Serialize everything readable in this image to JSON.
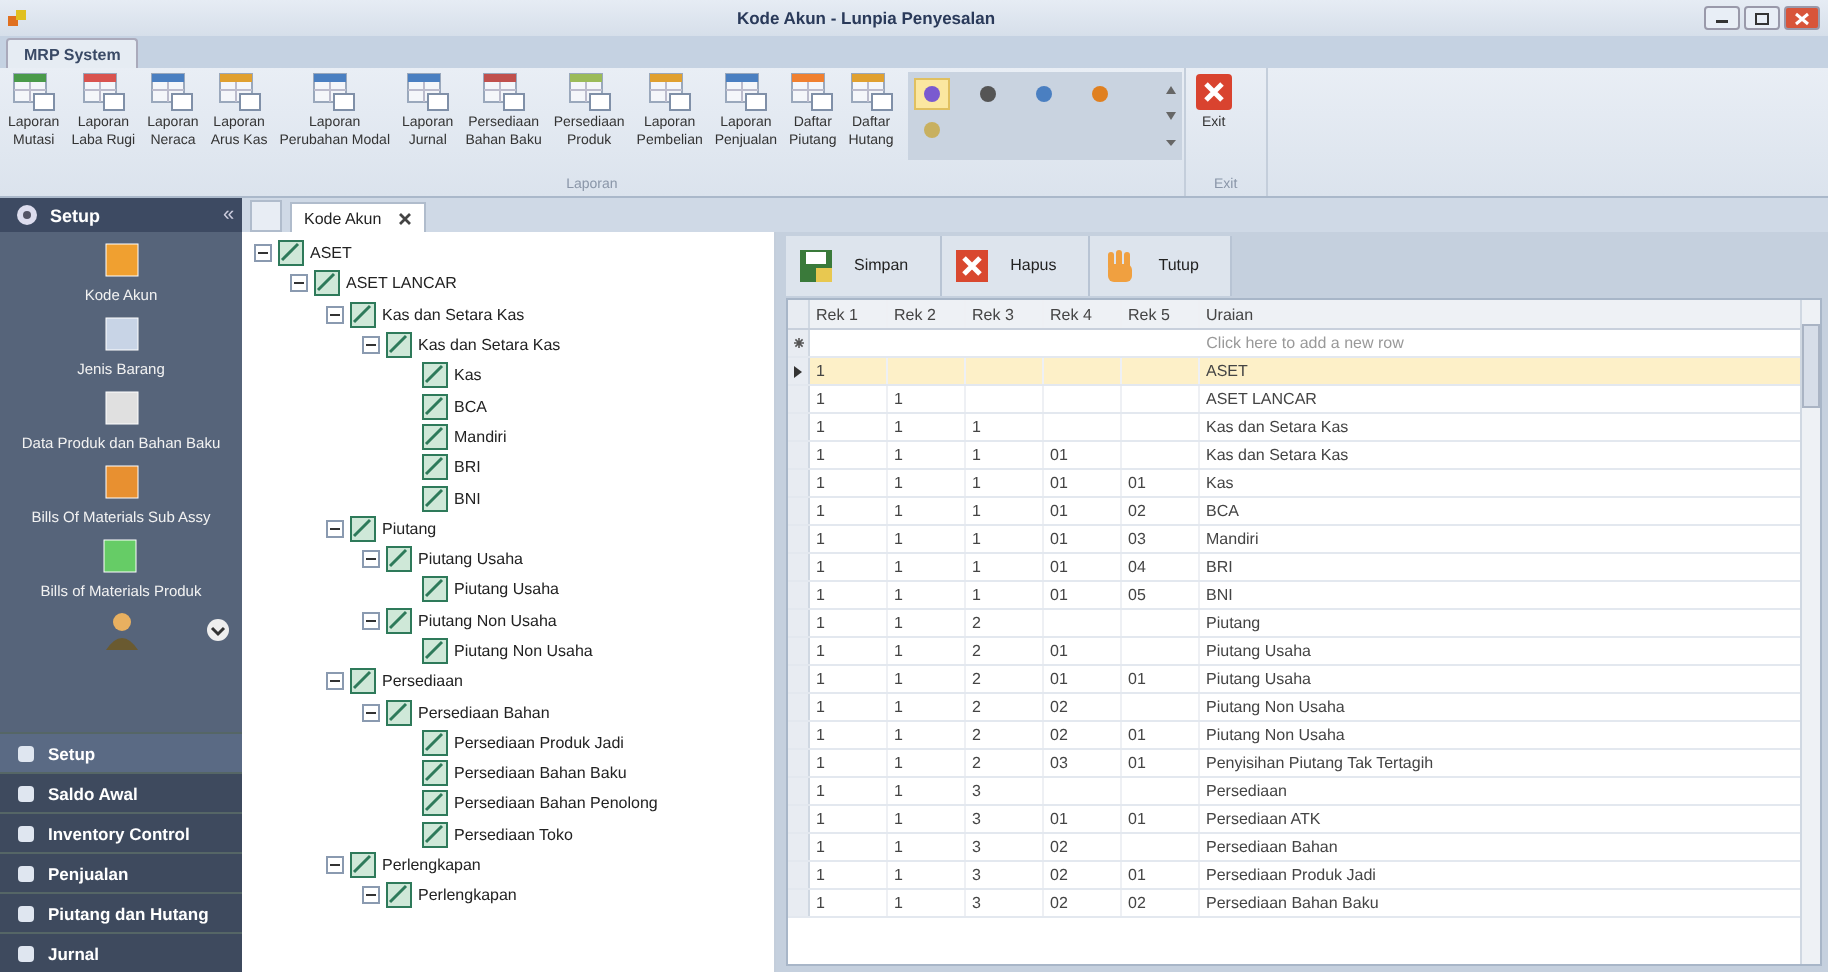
{
  "window": {
    "title": "Kode Akun - Lunpia Penyesalan"
  },
  "ribbon": {
    "tabs": [
      {
        "label": "MRP System",
        "selected": true
      }
    ],
    "report_group": {
      "label": "Laporan",
      "buttons": [
        {
          "lines": [
            "Laporan",
            "Mutasi"
          ]
        },
        {
          "lines": [
            "Laporan",
            "Laba Rugi"
          ]
        },
        {
          "lines": [
            "Laporan",
            "Neraca"
          ]
        },
        {
          "lines": [
            "Laporan",
            "Arus Kas"
          ]
        },
        {
          "lines": [
            "Laporan",
            "Perubahan Modal"
          ]
        },
        {
          "lines": [
            "Laporan",
            "Jurnal"
          ]
        },
        {
          "lines": [
            "Persediaan",
            "Bahan Baku"
          ]
        },
        {
          "lines": [
            "Persediaan",
            "Produk"
          ]
        },
        {
          "lines": [
            "Laporan",
            "Pembelian"
          ]
        },
        {
          "lines": [
            "Laporan",
            "Penjualan"
          ]
        },
        {
          "lines": [
            "Daftar",
            "Piutang"
          ]
        },
        {
          "lines": [
            "Daftar",
            "Hutang"
          ]
        }
      ]
    },
    "gallery": [
      {
        "selected": true
      },
      {
        "selected": false
      },
      {
        "selected": false
      },
      {
        "selected": false
      },
      {
        "selected": false
      }
    ],
    "exit_group": {
      "label": "Exit",
      "button": "Exit"
    }
  },
  "sidebar": {
    "header": "Setup",
    "collapse_glyph": "«",
    "items": [
      {
        "label": "Kode Akun"
      },
      {
        "label": "Jenis Barang"
      },
      {
        "label": "Data Produk dan Bahan Baku"
      },
      {
        "label": "Bills Of Materials Sub Assy"
      },
      {
        "label": "Bills of Materials Produk"
      }
    ],
    "nav": [
      {
        "label": "Setup",
        "selected": true
      },
      {
        "label": "Saldo Awal",
        "selected": false
      },
      {
        "label": "Inventory Control",
        "selected": false
      },
      {
        "label": "Penjualan",
        "selected": false
      },
      {
        "label": "Piutang dan Hutang",
        "selected": false
      },
      {
        "label": "Jurnal",
        "selected": false
      }
    ]
  },
  "document_tabs": [
    {
      "label": "Kode Akun",
      "selected": true
    }
  ],
  "tree": [
    {
      "label": "ASET",
      "expanded": true,
      "children": [
        {
          "label": "ASET LANCAR",
          "expanded": true,
          "children": [
            {
              "label": "Kas dan Setara Kas",
              "expanded": true,
              "children": [
                {
                  "label": "Kas dan Setara Kas",
                  "expanded": true,
                  "children": [
                    {
                      "label": "Kas"
                    },
                    {
                      "label": "BCA"
                    },
                    {
                      "label": "Mandiri"
                    },
                    {
                      "label": "BRI"
                    },
                    {
                      "label": "BNI"
                    }
                  ]
                }
              ]
            },
            {
              "label": "Piutang",
              "expanded": true,
              "children": [
                {
                  "label": "Piutang Usaha",
                  "expanded": true,
                  "children": [
                    {
                      "label": "Piutang Usaha"
                    }
                  ]
                },
                {
                  "label": "Piutang Non Usaha",
                  "expanded": true,
                  "children": [
                    {
                      "label": "Piutang Non Usaha"
                    }
                  ]
                }
              ]
            },
            {
              "label": "Persediaan",
              "expanded": true,
              "children": [
                {
                  "label": "Persediaan Bahan",
                  "expanded": true,
                  "children": [
                    {
                      "label": "Persediaan Produk Jadi"
                    },
                    {
                      "label": "Persediaan Bahan Baku"
                    },
                    {
                      "label": "Persediaan Bahan Penolong"
                    },
                    {
                      "label": "Persediaan Toko"
                    }
                  ]
                }
              ]
            },
            {
              "label": "Perlengkapan",
              "expanded": true,
              "children": [
                {
                  "label": "Perlengkapan",
                  "expanded": true
                }
              ]
            }
          ]
        }
      ]
    }
  ],
  "toolbar": [
    "Simpan",
    "Hapus",
    "Tutup"
  ],
  "table": {
    "columns": [
      "Rek 1",
      "Rek 2",
      "Rek 3",
      "Rek 4",
      "Rek 5",
      "Uraian"
    ],
    "new_row_placeholder": "Click here to add a new row",
    "rows": [
      {
        "cells": [
          "1",
          null,
          null,
          null,
          null,
          "ASET"
        ],
        "selected": true
      },
      {
        "cells": [
          "1",
          "1",
          null,
          null,
          null,
          "ASET LANCAR"
        ],
        "selected": false
      },
      {
        "cells": [
          "1",
          "1",
          "1",
          null,
          null,
          "Kas dan Setara Kas"
        ],
        "selected": false
      },
      {
        "cells": [
          "1",
          "1",
          "1",
          "01",
          null,
          "Kas dan Setara Kas"
        ],
        "selected": false
      },
      {
        "cells": [
          "1",
          "1",
          "1",
          "01",
          "01",
          "Kas"
        ],
        "selected": false
      },
      {
        "cells": [
          "1",
          "1",
          "1",
          "01",
          "02",
          "BCA"
        ],
        "selected": false
      },
      {
        "cells": [
          "1",
          "1",
          "1",
          "01",
          "03",
          "Mandiri"
        ],
        "selected": false
      },
      {
        "cells": [
          "1",
          "1",
          "1",
          "01",
          "04",
          "BRI"
        ],
        "selected": false
      },
      {
        "cells": [
          "1",
          "1",
          "1",
          "01",
          "05",
          "BNI"
        ],
        "selected": false
      },
      {
        "cells": [
          "1",
          "1",
          "2",
          null,
          null,
          "Piutang"
        ],
        "selected": false
      },
      {
        "cells": [
          "1",
          "1",
          "2",
          "01",
          null,
          "Piutang Usaha"
        ],
        "selected": false
      },
      {
        "cells": [
          "1",
          "1",
          "2",
          "01",
          "01",
          "Piutang Usaha"
        ],
        "selected": false
      },
      {
        "cells": [
          "1",
          "1",
          "2",
          "02",
          null,
          "Piutang Non Usaha"
        ],
        "selected": false
      },
      {
        "cells": [
          "1",
          "1",
          "2",
          "02",
          "01",
          "Piutang Non Usaha"
        ],
        "selected": false
      },
      {
        "cells": [
          "1",
          "1",
          "2",
          "03",
          "01",
          "Penyisihan Piutang Tak Tertagih"
        ],
        "selected": false
      },
      {
        "cells": [
          "1",
          "1",
          "3",
          null,
          null,
          "Persediaan"
        ],
        "selected": false
      },
      {
        "cells": [
          "1",
          "1",
          "3",
          "01",
          "01",
          "Persediaan ATK"
        ],
        "selected": false
      },
      {
        "cells": [
          "1",
          "1",
          "3",
          "02",
          null,
          "Persediaan Bahan"
        ],
        "selected": false
      },
      {
        "cells": [
          "1",
          "1",
          "3",
          "02",
          "01",
          "Persediaan Produk Jadi"
        ],
        "selected": false
      },
      {
        "cells": [
          "1",
          "1",
          "3",
          "02",
          "02",
          "Persediaan Bahan Baku"
        ],
        "selected": false
      }
    ]
  }
}
